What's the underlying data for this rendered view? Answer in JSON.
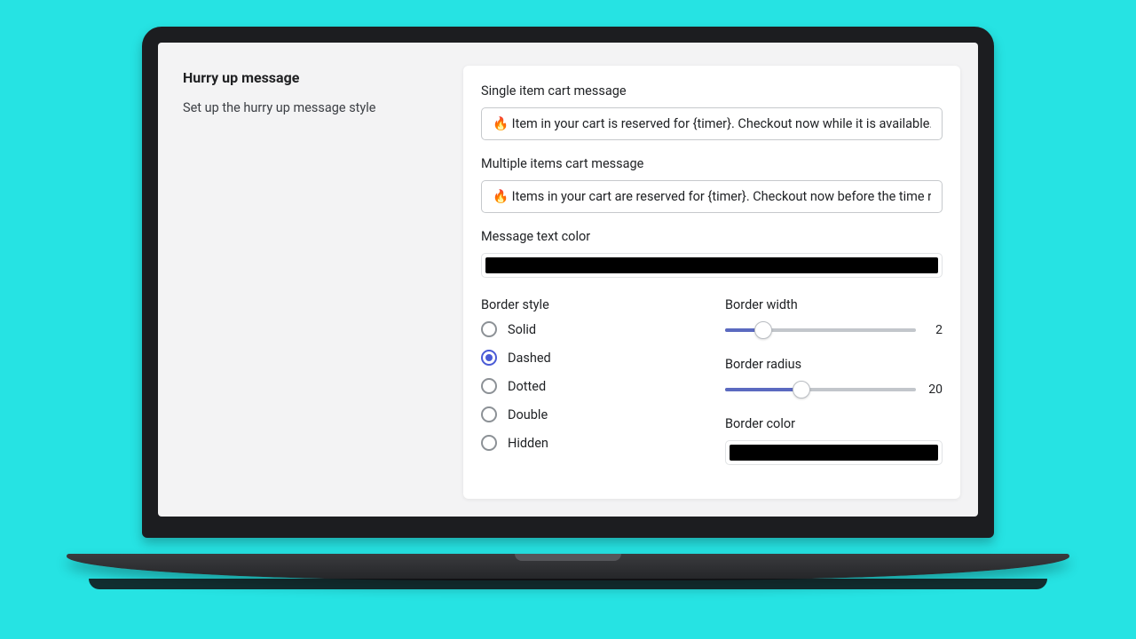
{
  "sidebar": {
    "title": "Hurry up message",
    "description": "Set up the hurry up message style"
  },
  "fields": {
    "single_label": "Single item cart message",
    "single_value": "🔥 Item in your cart is reserved for {timer}. Checkout now while it is available. 🔥",
    "multi_label": "Multiple items cart message",
    "multi_value": "🔥 Items in your cart are reserved for {timer}. Checkout now before the time runs out. 🔥",
    "text_color_label": "Message text color",
    "text_color_value": "#000000"
  },
  "border_style": {
    "label": "Border style",
    "options": [
      "Solid",
      "Dashed",
      "Dotted",
      "Double",
      "Hidden"
    ],
    "selected": "Dashed"
  },
  "border_width": {
    "label": "Border width",
    "value": 2,
    "min": 0,
    "max": 10
  },
  "border_radius": {
    "label": "Border radius",
    "value": 20,
    "min": 0,
    "max": 50
  },
  "border_color": {
    "label": "Border color",
    "value": "#000000"
  }
}
